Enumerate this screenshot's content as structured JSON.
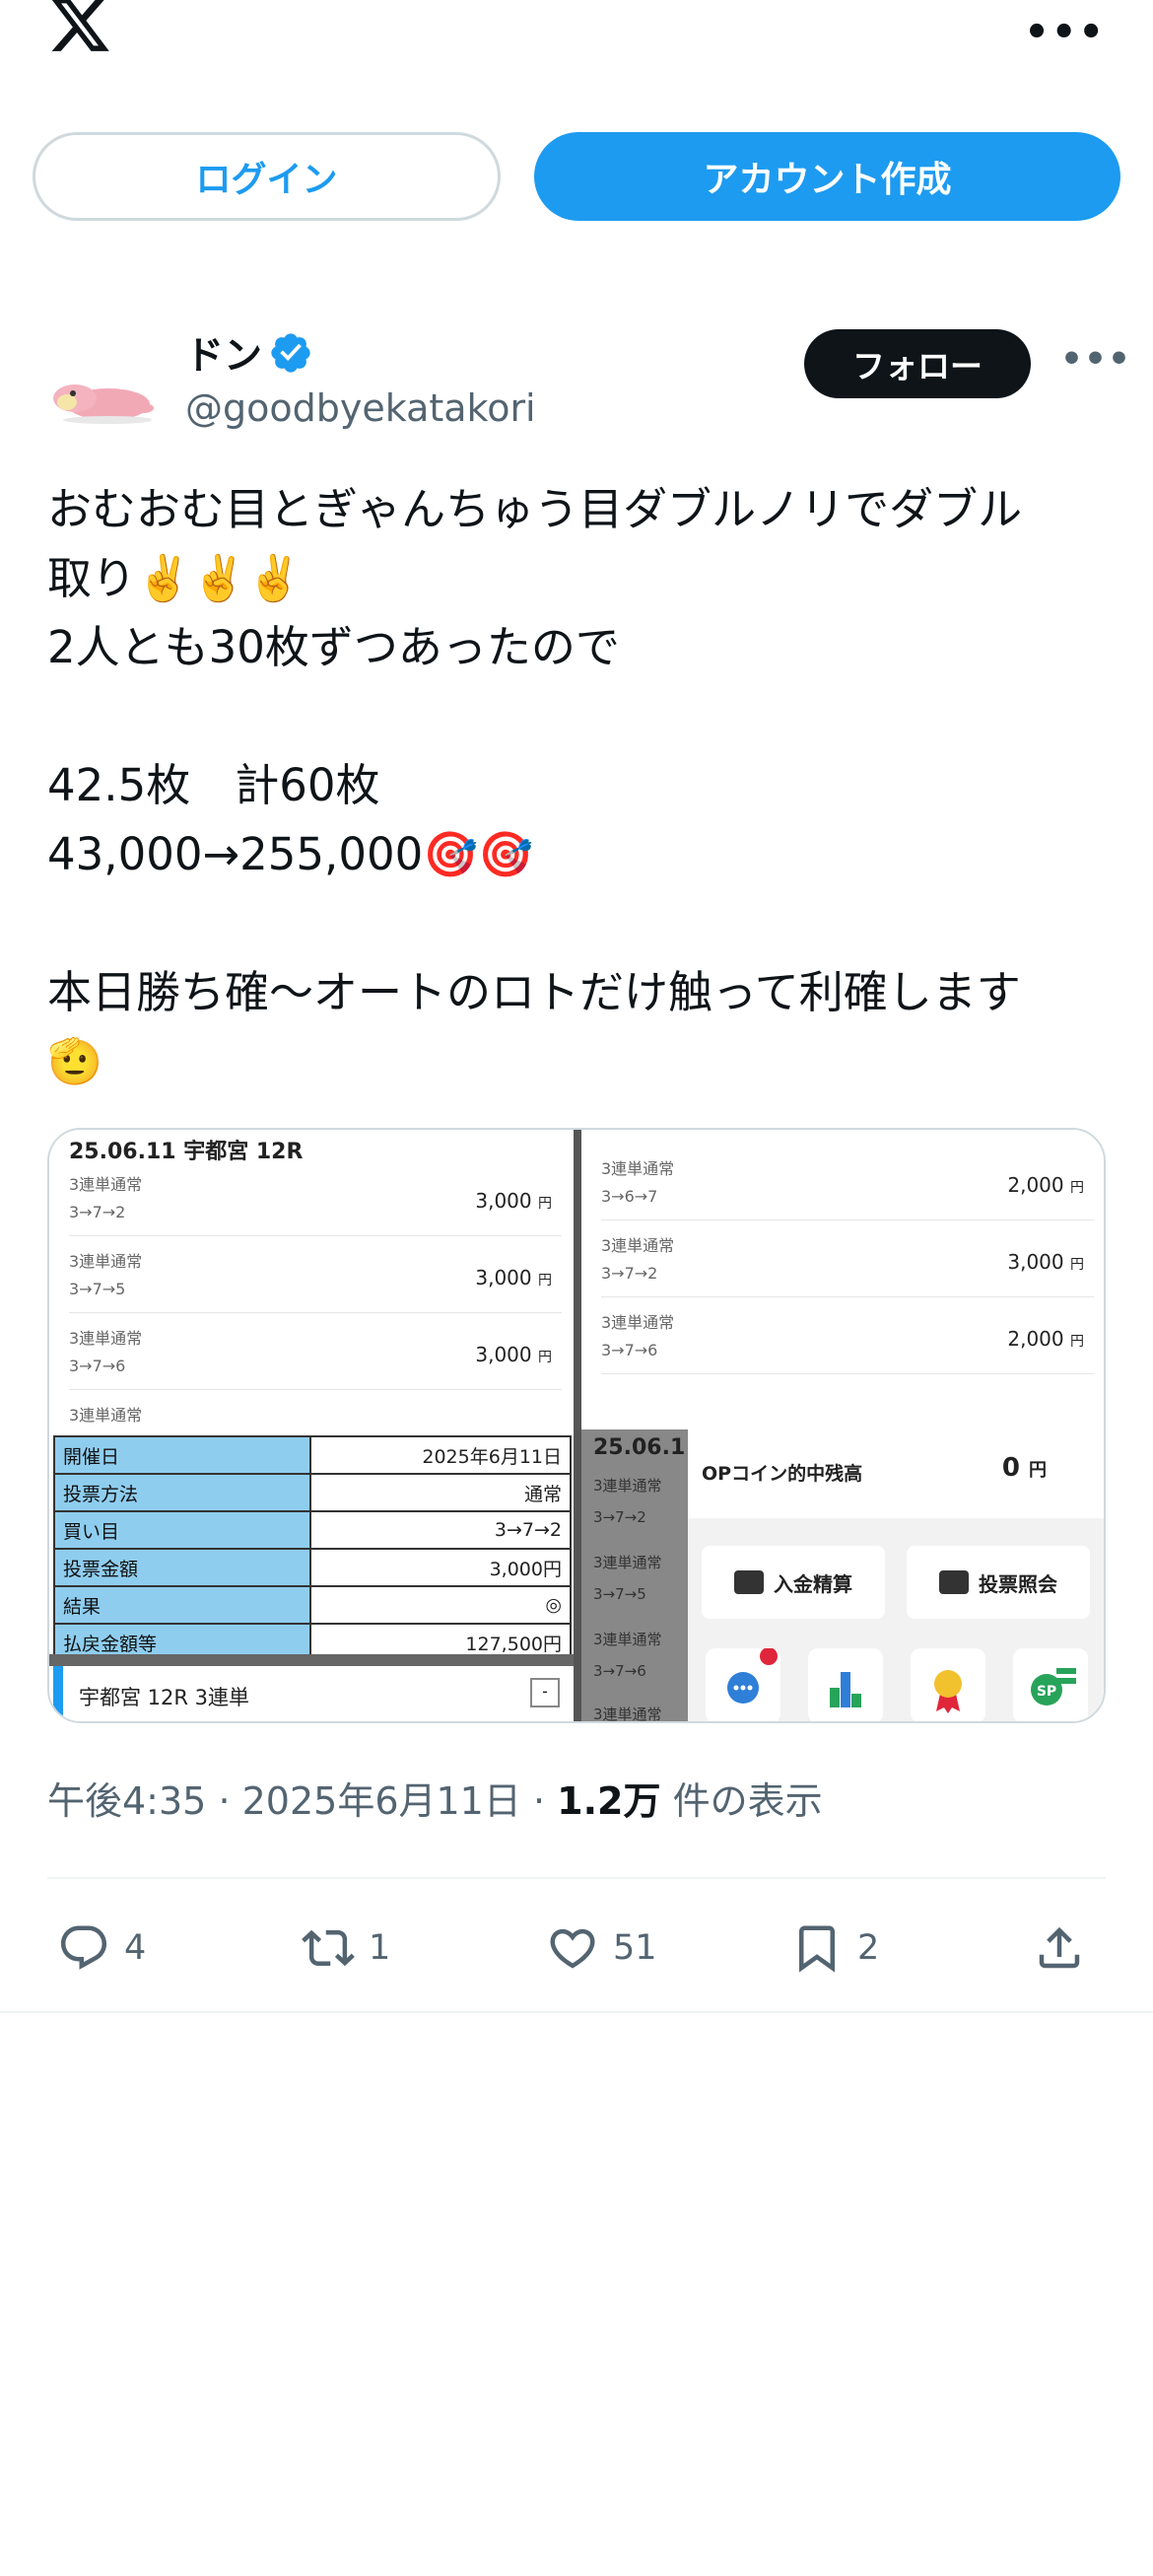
{
  "topbar": {
    "logo_icon": "x-logo-icon",
    "more_icon": "more-horizontal-icon",
    "more_label": "•••"
  },
  "auth": {
    "login_label": "ログイン",
    "signup_label": "アカウント作成"
  },
  "author": {
    "name": "ドン",
    "handle": "@goodbyekatakori",
    "verified": true,
    "follow_label": "フォロー",
    "more_label": "•••"
  },
  "tweet": {
    "lines": [
      "おむおむ目とぎゃんちゅう目ダブルノリでダブル",
      "取り✌️✌️✌️",
      "2人とも30枚ずつあったので",
      "",
      "42.5枚　計60枚",
      "43,000→255,000🎯🎯",
      "",
      "本日勝ち確〜オートのロトだけ触って利確します",
      "🫡"
    ]
  },
  "media": {
    "tl": {
      "title": "25.06.11 宇都宮 12R",
      "tickets": [
        {
          "type": "3連単通常",
          "combo": "3→7→2",
          "amount": "3,000",
          "unit": "円"
        },
        {
          "type": "3連単通常",
          "combo": "3→7→5",
          "amount": "3,000",
          "unit": "円"
        },
        {
          "type": "3連単通常",
          "combo": "3→7→6",
          "amount": "3,000",
          "unit": "円"
        },
        {
          "type": "3連単通常",
          "combo": "",
          "amount": "",
          "unit": ""
        }
      ]
    },
    "tr": {
      "tickets": [
        {
          "type": "3連単通常",
          "combo": "3→6→7",
          "amount": "2,000",
          "unit": "円"
        },
        {
          "type": "3連単通常",
          "combo": "3→7→2",
          "amount": "3,000",
          "unit": "円"
        },
        {
          "type": "3連単通常",
          "combo": "3→7→6",
          "amount": "2,000",
          "unit": "円"
        }
      ]
    },
    "bl": {
      "rows": [
        {
          "k": "開催日",
          "v": "2025年6月11日"
        },
        {
          "k": "投票方法",
          "v": "通常"
        },
        {
          "k": "買い目",
          "v": "3→7→2"
        },
        {
          "k": "投票金額",
          "v": "3,000円"
        },
        {
          "k": "結果",
          "v": "◎"
        },
        {
          "k": "払戻金額等",
          "v": "127,500円"
        }
      ],
      "footer": "宇都宮 12R 3連単",
      "footer_box": "-"
    },
    "br": {
      "dark_title": "25.06.1",
      "dark_items": [
        "3連単通常",
        "3→7→2",
        "3連単通常",
        "3→7→5",
        "3連単通常",
        "3→7→6",
        "3連単通常"
      ],
      "coin_label": "OPコイン的中残高",
      "coin_value": "0",
      "coin_unit": "円",
      "btn_deposit": "入金精算",
      "btn_inquiry": "投票照会"
    }
  },
  "meta": {
    "time": "午後4:35",
    "sep": "·",
    "date": "2025年6月11日",
    "views": "1.2万",
    "views_label": "件の表示"
  },
  "actions": {
    "replies": "4",
    "reposts": "1",
    "likes": "51",
    "bookmarks": "2"
  },
  "colors": {
    "accent": "#1d9bf0",
    "text": "#0f1419",
    "muted": "#536471",
    "border": "#cfd9de"
  }
}
